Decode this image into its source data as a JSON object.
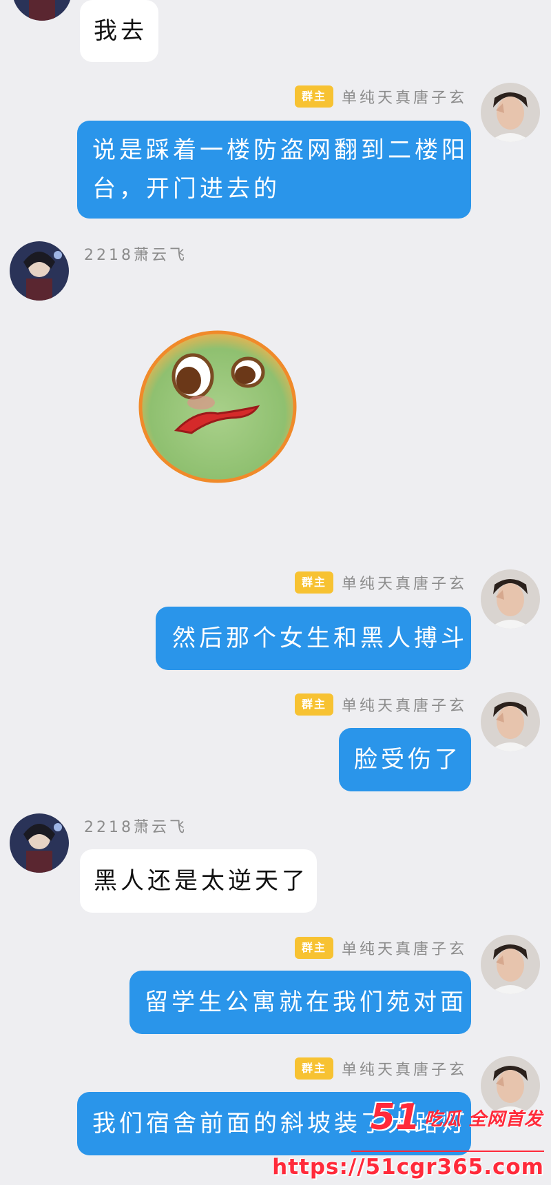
{
  "chat": {
    "messages": [
      {
        "side": "in",
        "text": "我去"
      },
      {
        "side": "out",
        "badge": "群主",
        "sender": "单纯天真唐子玄",
        "line1": "说是踩着一楼防盗网翻到二楼阳",
        "line2": "台，开门进去的"
      },
      {
        "side": "in",
        "sender": "2218萧云飞",
        "sticker": "green-face-sticker"
      },
      {
        "side": "out",
        "badge": "群主",
        "sender": "单纯天真唐子玄",
        "text": "然后那个女生和黑人搏斗"
      },
      {
        "side": "out",
        "badge": "群主",
        "sender": "单纯天真唐子玄",
        "text": "脸受伤了"
      },
      {
        "side": "in",
        "sender": "2218萧云飞",
        "text": "黑人还是太逆天了"
      },
      {
        "side": "out",
        "badge": "群主",
        "sender": "单纯天真唐子玄",
        "text": "留学生公寓就在我们苑对面"
      },
      {
        "side": "out",
        "badge": "群主",
        "sender": "单纯天真唐子玄",
        "text": "我们宿舍前面的斜坡装了大路灯"
      }
    ]
  },
  "watermark": {
    "logo_number": "51",
    "logo_text": "吃瓜 全网首发",
    "url": "https://51cgr365.com"
  },
  "colors": {
    "background": "#eeeef1",
    "outgoing_bubble": "#2a95ea",
    "incoming_bubble": "#ffffff",
    "owner_badge": "#f7c232",
    "watermark": "#ff2a3a"
  }
}
